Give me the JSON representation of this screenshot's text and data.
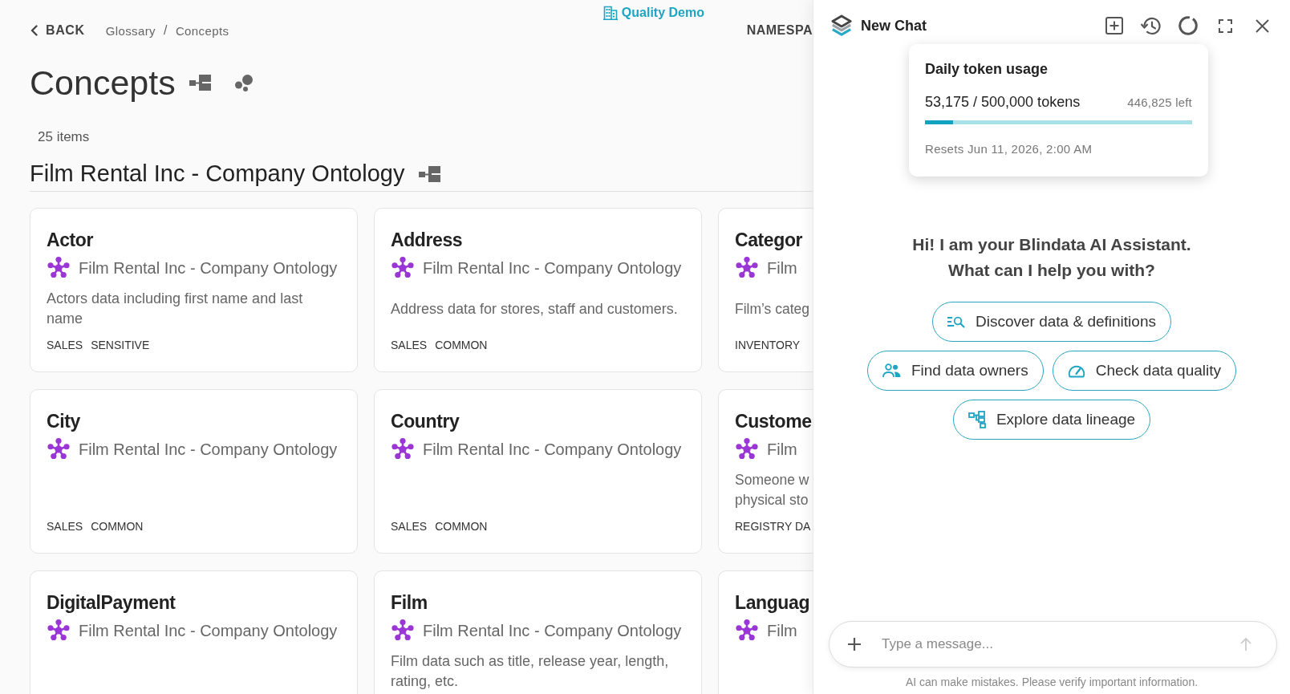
{
  "header": {
    "tenant": "Quality Demo",
    "back": "BACK",
    "breadcrumbs": [
      "Glossary",
      "Concepts"
    ],
    "separator": "/",
    "namespace": "NAMESPA"
  },
  "page": {
    "title": "Concepts",
    "item_count": "25 items",
    "group_title": "Film Rental Inc - Company Ontology"
  },
  "cards": [
    {
      "title": "Actor",
      "ontology": "Film Rental Inc - Company Ontology",
      "description": "Actors data including first name and last name",
      "tags": [
        "SALES",
        "SENSITIVE"
      ]
    },
    {
      "title": "Address",
      "ontology": "Film Rental Inc - Company Ontology",
      "description": "Address data for stores, staff and customers.",
      "tags": [
        "SALES",
        "COMMON"
      ]
    },
    {
      "title": "Categor",
      "ontology": "Film",
      "description": "Film’s categ",
      "tags": [
        "INVENTORY"
      ]
    },
    {
      "title": "City",
      "ontology": "Film Rental Inc - Company Ontology",
      "tags": [
        "SALES",
        "COMMON"
      ]
    },
    {
      "title": "Country",
      "ontology": "Film Rental Inc - Company Ontology",
      "tags": [
        "SALES",
        "COMMON"
      ]
    },
    {
      "title": "Custome",
      "ontology": "Film",
      "description": "Someone w\nphysical sto",
      "tags": [
        "REGISTRY DA"
      ]
    },
    {
      "title": "DigitalPayment",
      "ontology": "Film Rental Inc - Company Ontology"
    },
    {
      "title": "Film",
      "ontology": "Film Rental Inc - Company Ontology",
      "description": "Film data such as title, release year, length, rating, etc."
    },
    {
      "title": "Languag",
      "ontology": "Film"
    }
  ],
  "chat": {
    "title": "New Chat",
    "token_usage": {
      "title": "Daily token usage",
      "usage": "53,175 / 500,000 tokens",
      "remaining": "446,825 left",
      "level": 0.106,
      "resets": "Resets Jun 11, 2026, 2:00 AM"
    },
    "greeting": [
      "Hi! I am your Blindata AI Assistant.",
      "What can I help you with?"
    ],
    "suggestion_rows": [
      [
        {
          "label": "Discover data & definitions",
          "kind": "discover"
        }
      ],
      [
        {
          "label": "Find data owners",
          "kind": "owners"
        },
        {
          "label": "Check data quality",
          "kind": "quality"
        }
      ],
      [
        {
          "label": "Explore data lineage",
          "kind": "lineage"
        }
      ]
    ],
    "input": {
      "placeholder": "Type a message..."
    },
    "disclaimer": "AI can make mistakes. Please verify important information."
  }
}
